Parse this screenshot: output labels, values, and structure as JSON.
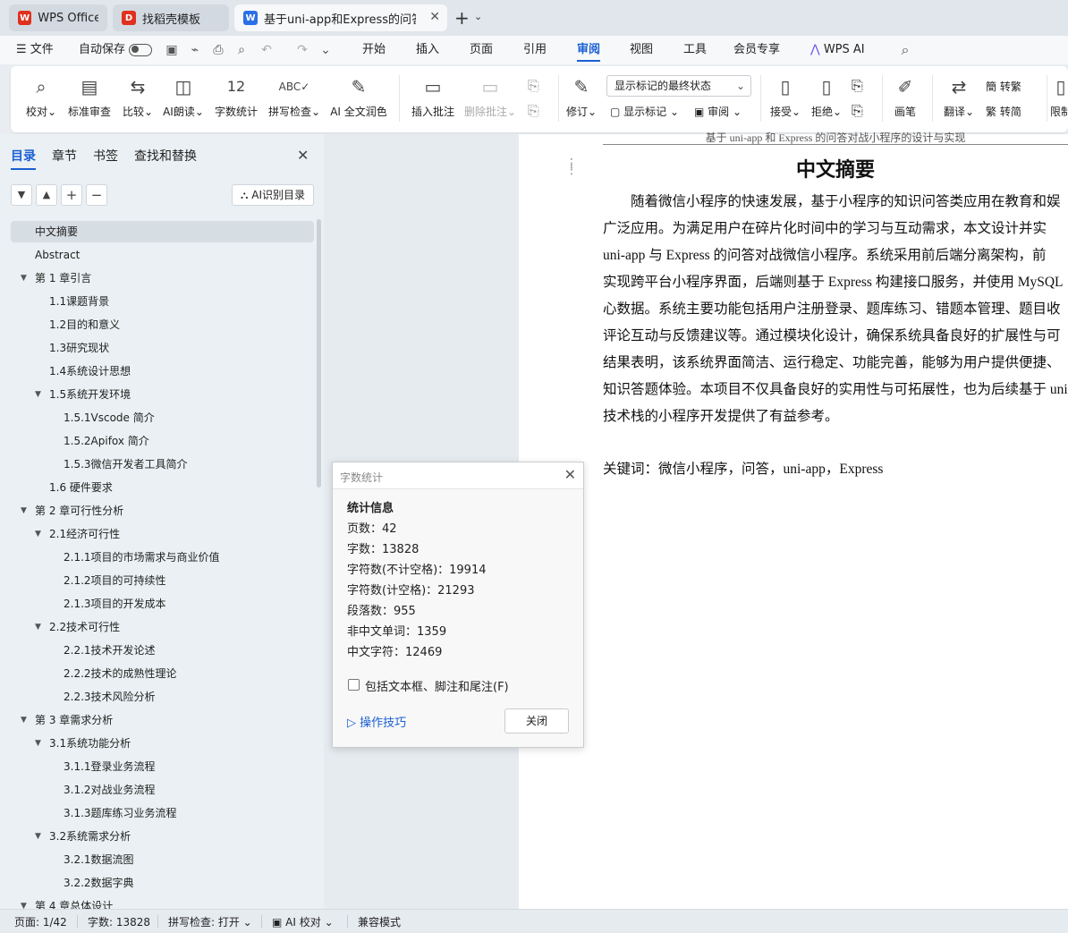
{
  "tabs": [
    {
      "label": "WPS Office",
      "icon": "wps-logo-icon"
    },
    {
      "label": "找稻壳模板",
      "icon": "docer-icon"
    },
    {
      "label": "基于uni-app和Express的问答",
      "icon": "word-doc-icon"
    }
  ],
  "menu": {
    "file": "文件",
    "autosave": "自动保存",
    "items": [
      "开始",
      "插入",
      "页面",
      "引用",
      "审阅",
      "视图",
      "工具",
      "会员专享",
      "WPS AI"
    ],
    "active": "审阅"
  },
  "ribbon": {
    "proofread": "校对",
    "standard_review": "标准审查",
    "compare": "比较",
    "ai_read": "AI朗读",
    "word_count": "字数统计",
    "spell_check": "拼写检查",
    "ai_polish": "AI 全文润色",
    "insert_comment": "插入批注",
    "delete_comment": "删除批注",
    "revise": "修订",
    "mark_state": "显示标记的最终状态",
    "show_marks": "显示标记",
    "review": "审阅",
    "accept": "接受",
    "reject": "拒绝",
    "pen": "画笔",
    "translate": "翻译",
    "to_traditional": "转繁",
    "to_simplified": "转简",
    "restrict": "限制"
  },
  "panel": {
    "tabs": [
      "目录",
      "章节",
      "书签",
      "查找和替换"
    ],
    "active_tab": "目录",
    "ai_toc_button": "AI识别目录",
    "toc": [
      {
        "text": "中文摘要",
        "level": 0,
        "arrow": ""
      },
      {
        "text": "Abstract",
        "level": 0,
        "arrow": ""
      },
      {
        "text": "第 1 章引言",
        "level": 0,
        "arrow": "▼"
      },
      {
        "text": "1.1课题背景",
        "level": 1,
        "arrow": ""
      },
      {
        "text": "1.2目的和意义",
        "level": 1,
        "arrow": ""
      },
      {
        "text": "1.3研究现状",
        "level": 1,
        "arrow": ""
      },
      {
        "text": "1.4系统设计思想",
        "level": 1,
        "arrow": ""
      },
      {
        "text": "1.5系统开发环境",
        "level": 1,
        "arrow": "▼"
      },
      {
        "text": "1.5.1Vscode 简介",
        "level": 2,
        "arrow": ""
      },
      {
        "text": "1.5.2Apifox 简介",
        "level": 2,
        "arrow": ""
      },
      {
        "text": "1.5.3微信开发者工具简介",
        "level": 2,
        "arrow": ""
      },
      {
        "text": "1.6  硬件要求",
        "level": 1,
        "arrow": ""
      },
      {
        "text": "第 2 章可行性分析",
        "level": 0,
        "arrow": "▼"
      },
      {
        "text": "2.1经济可行性",
        "level": 1,
        "arrow": "▼"
      },
      {
        "text": "2.1.1项目的市场需求与商业价值",
        "level": 2,
        "arrow": ""
      },
      {
        "text": "2.1.2项目的可持续性",
        "level": 2,
        "arrow": ""
      },
      {
        "text": "2.1.3项目的开发成本",
        "level": 2,
        "arrow": ""
      },
      {
        "text": "2.2技术可行性",
        "level": 1,
        "arrow": "▼"
      },
      {
        "text": "2.2.1技术开发论述",
        "level": 2,
        "arrow": ""
      },
      {
        "text": "2.2.2技术的成熟性理论",
        "level": 2,
        "arrow": ""
      },
      {
        "text": "2.2.3技术风险分析",
        "level": 2,
        "arrow": ""
      },
      {
        "text": "第 3 章需求分析",
        "level": 0,
        "arrow": "▼"
      },
      {
        "text": "3.1系统功能分析",
        "level": 1,
        "arrow": "▼"
      },
      {
        "text": "3.1.1登录业务流程",
        "level": 2,
        "arrow": ""
      },
      {
        "text": "3.1.2对战业务流程",
        "level": 2,
        "arrow": ""
      },
      {
        "text": "3.1.3题库练习业务流程",
        "level": 2,
        "arrow": ""
      },
      {
        "text": "3.2系统需求分析",
        "level": 1,
        "arrow": "▼"
      },
      {
        "text": "3.2.1数据流图",
        "level": 2,
        "arrow": ""
      },
      {
        "text": "3.2.2数据字典",
        "level": 2,
        "arrow": ""
      },
      {
        "text": "第 4 章总体设计",
        "level": 0,
        "arrow": "▼"
      }
    ]
  },
  "document": {
    "header": "基于 uni-app 和 Express 的问答对战小程序的设计与实现",
    "title": "中文摘要",
    "lines": [
      "　　随着微信小程序的快速发展，基于小程序的知识问答类应用在教育和娱",
      "广泛应用。为满足用户在碎片化时间中的学习与互动需求，本文设计并实",
      "uni-app 与  Express 的问答对战微信小程序。系统采用前后端分离架构，前",
      "实现跨平台小程序界面，后端则基于 Express 构建接口服务，并使用 MySQL",
      "心数据。系统主要功能包括用户注册登录、题库练习、错题本管理、题目收",
      "评论互动与反馈建议等。通过模块化设计，确保系统具备良好的扩展性与可",
      "结果表明，该系统界面简洁、运行稳定、功能完善，能够为用户提供便捷、",
      "知识答题体验。本项目不仅具备良好的实用性与可拓展性，也为后续基于 uni",
      "技术栈的小程序开发提供了有益参考。"
    ],
    "keywords": "关键词：微信小程序，问答，uni-app，Express"
  },
  "dialog": {
    "title": "字数统计",
    "heading": "统计信息",
    "stats": [
      "页数：42",
      "字数：13828",
      "字符数(不计空格)：19914",
      "字符数(计空格)：21293",
      "段落数：955",
      "非中文单词：1359",
      "中文字符：12469"
    ],
    "include_label": "包括文本框、脚注和尾注(F)",
    "tips": "操作技巧",
    "close": "关闭"
  },
  "status": {
    "page": "页面: 1/42",
    "words": "字数: 13828",
    "spell": "拼写检查: 打开",
    "ai_proof": "AI 校对",
    "compat": "兼容模式"
  }
}
